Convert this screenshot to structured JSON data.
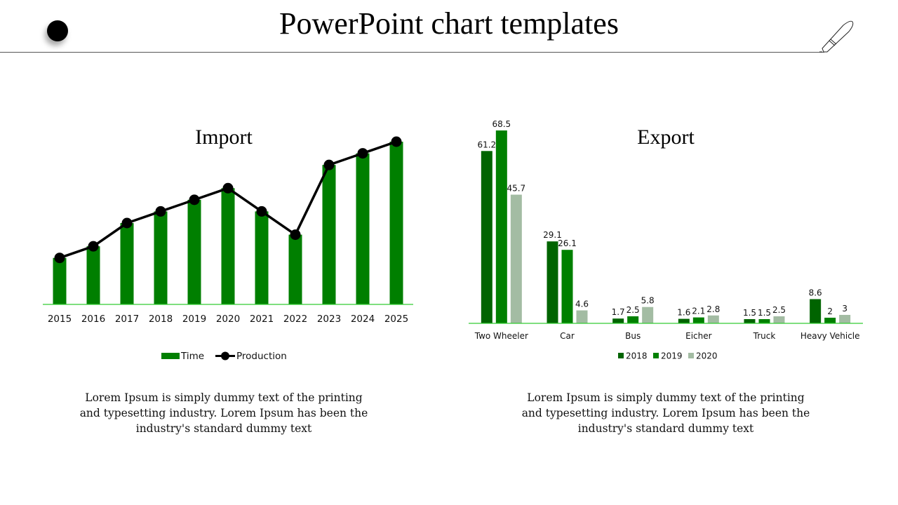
{
  "page": {
    "title": "PowerPoint chart templates",
    "icons": [
      "bullet-dot-icon",
      "pen-icon"
    ]
  },
  "descriptions": {
    "left": "Lorem Ipsum is simply dummy text of the printing and typesetting industry. Lorem Ipsum has been the industry's standard dummy text",
    "right": "Lorem Ipsum is simply dummy text of the printing and typesetting industry. Lorem Ipsum has been the industry's standard dummy text"
  },
  "colors": {
    "bar_green": "#007F00",
    "axis_green": "#33CC33",
    "line_black": "#000000",
    "s2018": "#006400",
    "s2019": "#008000",
    "s2020": "#A3BCA3"
  },
  "chart_data": [
    {
      "type": "bar",
      "title": "Import",
      "categories": [
        "2015",
        "2016",
        "2017",
        "2018",
        "2019",
        "2020",
        "2021",
        "2022",
        "2023",
        "2024",
        "2025"
      ],
      "series": [
        {
          "name": "Time",
          "kind": "bar",
          "values": [
            2,
            2.5,
            3.5,
            4,
            4.5,
            5,
            4,
            3,
            6,
            6.5,
            7
          ]
        },
        {
          "name": "Production",
          "kind": "line",
          "values": [
            2,
            2.5,
            3.5,
            4,
            4.5,
            5,
            4,
            3,
            6,
            6.5,
            7
          ]
        }
      ],
      "xlabel": "",
      "ylabel": "",
      "ylim": [
        0,
        7
      ],
      "grid": false,
      "legend": "bottom"
    },
    {
      "type": "bar",
      "title": "Export",
      "categories": [
        "Two Wheeler",
        "Car",
        "Bus",
        "Eicher",
        "Truck",
        "Heavy Vehicle"
      ],
      "series": [
        {
          "name": "2018",
          "values": [
            61.2,
            29.1,
            1.7,
            1.6,
            1.5,
            8.6
          ]
        },
        {
          "name": "2019",
          "values": [
            68.5,
            26.1,
            2.5,
            2.1,
            1.5,
            2
          ]
        },
        {
          "name": "2020",
          "values": [
            45.7,
            4.6,
            5.8,
            2.8,
            2.5,
            3
          ]
        }
      ],
      "xlabel": "",
      "ylabel": "",
      "ylim": [
        0,
        68.5
      ],
      "grid": false,
      "data_labels": true,
      "legend": "bottom"
    }
  ]
}
